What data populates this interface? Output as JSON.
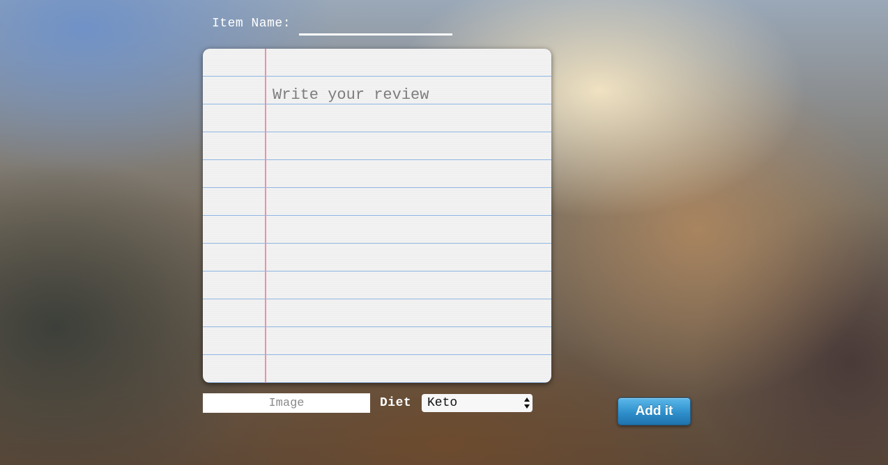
{
  "item_name": {
    "label": "Item Name:",
    "value": ""
  },
  "review": {
    "placeholder": "Write your review",
    "value": ""
  },
  "image_field": {
    "placeholder": "Image",
    "value": ""
  },
  "diet": {
    "label": "Diet",
    "selected": "Keto"
  },
  "submit": {
    "label": "Add it"
  },
  "colors": {
    "button": "#2e8fcb",
    "paper": "#f2f2f2",
    "rule_line": "#8fb7e3",
    "margin_line": "#ee8fa6"
  }
}
